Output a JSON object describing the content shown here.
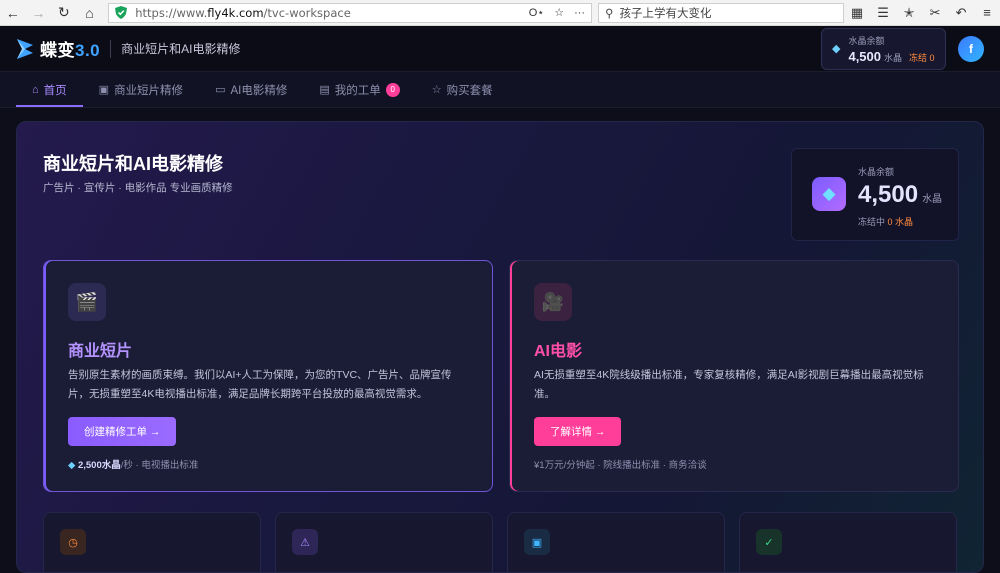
{
  "browser": {
    "url_prefix": "https://www.",
    "url_domain": "fly4k.com",
    "url_path": "/tvc-workspace",
    "search_text": "孩子上学有大变化"
  },
  "header": {
    "logo_text": "蝶变",
    "logo_version": "3.0",
    "subtitle": "商业短片和AI电影精修",
    "balance_label": "水晶余额",
    "balance_value": "4,500",
    "balance_unit": "水晶",
    "frozen_text": "冻结 0",
    "avatar_letter": "f"
  },
  "tabs": [
    {
      "label": "首页",
      "icon": "home-icon",
      "active": true
    },
    {
      "label": "商业短片精修",
      "icon": "camera-icon"
    },
    {
      "label": "AI电影精修",
      "icon": "film-icon"
    },
    {
      "label": "我的工单",
      "icon": "document-icon",
      "badge": "0"
    },
    {
      "label": "购买套餐",
      "icon": "star-icon"
    }
  ],
  "hero": {
    "title": "商业短片和AI电影精修",
    "subtitle": "广告片 · 宣传片 · 电影作品 专业画质精修",
    "balance_label": "水晶余额",
    "balance_value": "4,500",
    "balance_unit": "水晶",
    "frozen_prefix": "冻结中",
    "frozen_value": "0 水晶"
  },
  "cards": {
    "commercial": {
      "icon": "clapperboard-icon",
      "title": "商业短片",
      "desc": "告别原生素材的画质束缚。我们以AI+人工为保障，为您的TVC、广告片、品牌宣传片，无损重塑至4K电视播出标准，满足品牌长期跨平台投放的最高视觉需求。",
      "button": "创建精修工单 →",
      "price": "2,500水晶",
      "meta_suffix": "/秒 · 电视播出标准"
    },
    "ai_film": {
      "icon": "projector-icon",
      "title": "AI电影",
      "desc": "AI无损重塑至4K院线级播出标准，专家复核精修，满足AI影视剧巨幕播出最高视觉标准。",
      "button": "了解详情 →",
      "meta": "¥1万元/分钟起 · 院线播出标准 · 商务洽谈"
    }
  },
  "colors": {
    "accent_purple": "#8c6bff",
    "accent_pink": "#ff3e9a",
    "frozen_orange": "#ff8a3d",
    "background": "#0d0e1a"
  },
  "mini_cards": [
    {
      "icon": "clock-icon",
      "color": "#ff8a3d"
    },
    {
      "icon": "warning-icon",
      "color": "#a98bff"
    },
    {
      "icon": "camera-icon",
      "color": "#3fb6ff"
    },
    {
      "icon": "check-circle-icon",
      "color": "#3fd68a"
    }
  ]
}
